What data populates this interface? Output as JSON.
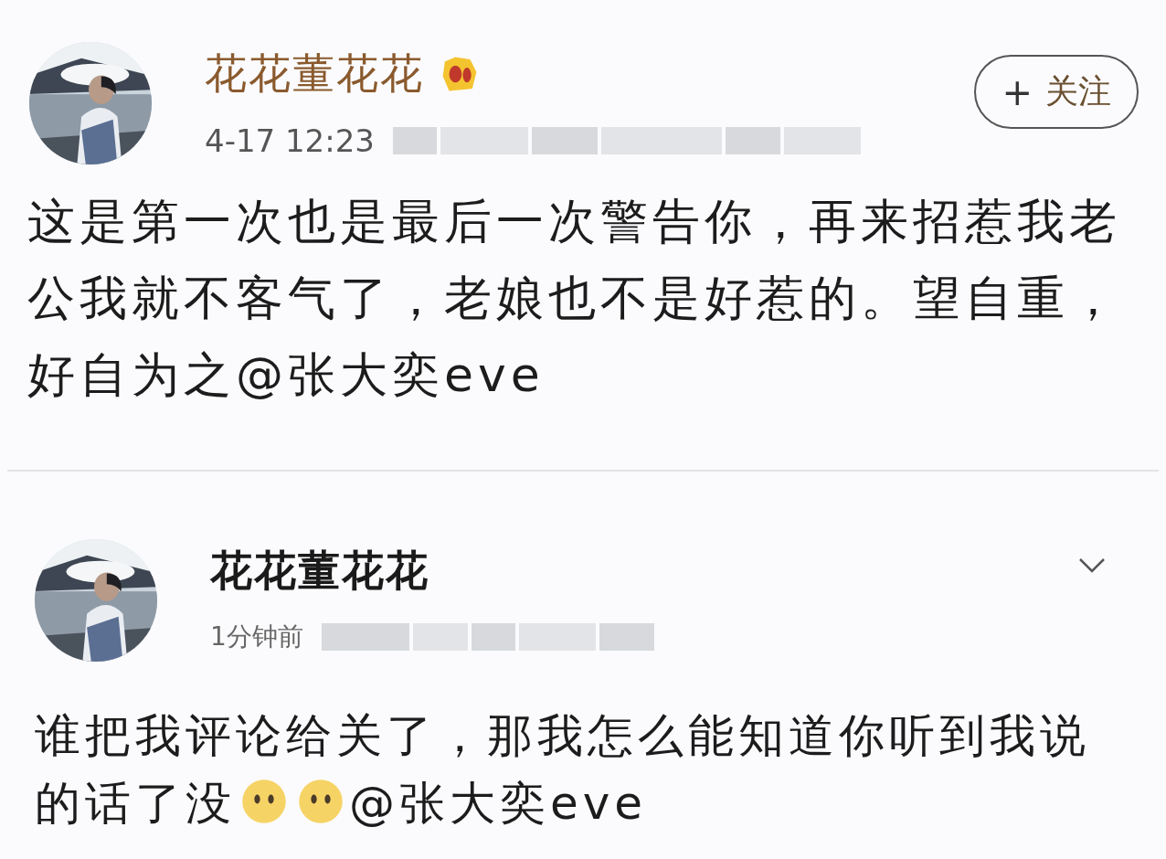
{
  "posts": [
    {
      "author": "花花董花花",
      "vip": true,
      "verified": true,
      "time": "4-17 12:23",
      "follow_button": {
        "plus": "+",
        "label": "关注"
      },
      "menu": false,
      "body": [
        {
          "kind": "text",
          "text": "这是第一次也是最后一次警告你，再来招惹我老公我就不客气了，老娘也不是好惹的。望自重，好自为之"
        },
        {
          "kind": "mention",
          "text": "@张大奕eve"
        }
      ]
    },
    {
      "author": "花花董花花",
      "vip": false,
      "verified": false,
      "time": "1分钟前",
      "menu": true,
      "body": [
        {
          "kind": "text",
          "text": "谁把我评论给关了，那我怎么能知道你听到我说的话了没"
        },
        {
          "kind": "emoji"
        },
        {
          "kind": "emoji"
        },
        {
          "kind": "mention",
          "text": "@张大奕eve"
        }
      ]
    }
  ]
}
